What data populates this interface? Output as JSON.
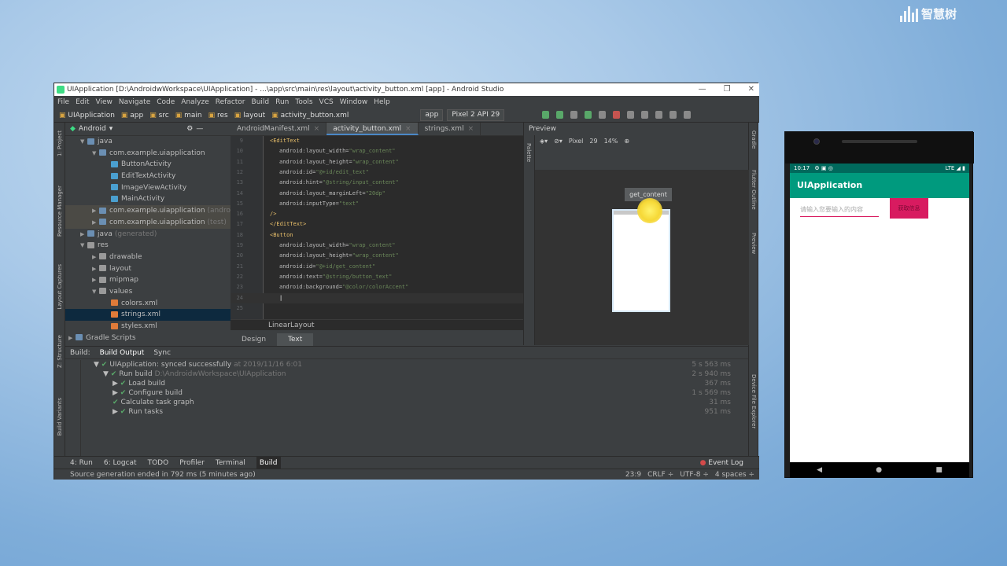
{
  "logo": {
    "text": "智慧树"
  },
  "studio": {
    "title": "UIApplication [D:\\AndroidwWorkspace\\UIApplication] - ...\\app\\src\\main\\res\\layout\\activity_button.xml [app] - Android Studio",
    "menu": [
      "File",
      "Edit",
      "View",
      "Navigate",
      "Code",
      "Analyze",
      "Refactor",
      "Build",
      "Run",
      "Tools",
      "VCS",
      "Window",
      "Help"
    ],
    "breadcrumbs": [
      "UIApplication",
      "app",
      "src",
      "main",
      "res",
      "layout",
      "activity_button.xml"
    ],
    "run_config": "app",
    "device": "Pixel 2 API 29",
    "left_strip": [
      "1: Project",
      "Resource Manager",
      "Layout Captures",
      "Z: Structure",
      "Build Variants"
    ],
    "right_strip": [
      "Gradle",
      "Flutter Outline",
      "Preview",
      "Device File Explorer"
    ],
    "project_view": "Android",
    "tree": [
      {
        "label": "java",
        "indent": 1,
        "arrow": "▼",
        "color": "#6b8fb3"
      },
      {
        "label": "com.example.uiapplication",
        "indent": 2,
        "arrow": "▼",
        "color": "#6b8fb3"
      },
      {
        "label": "ButtonActivity",
        "indent": 3,
        "arrow": "",
        "color": "#4a9fcf"
      },
      {
        "label": "EditTextActivity",
        "indent": 3,
        "arrow": "",
        "color": "#4a9fcf"
      },
      {
        "label": "ImageViewActivity",
        "indent": 3,
        "arrow": "",
        "color": "#4a9fcf"
      },
      {
        "label": "MainActivity",
        "indent": 3,
        "arrow": "",
        "color": "#4a9fcf"
      },
      {
        "label": "com.example.uiapplication",
        "suffix": "(androidTest)",
        "indent": 2,
        "arrow": "▶",
        "color": "#6b8fb3",
        "hl": true
      },
      {
        "label": "com.example.uiapplication",
        "suffix": "(test)",
        "indent": 2,
        "arrow": "▶",
        "color": "#6b8fb3",
        "hl": true
      },
      {
        "label": "java",
        "suffix": "(generated)",
        "indent": 1,
        "arrow": "▶",
        "color": "#6b8fb3"
      },
      {
        "label": "res",
        "indent": 1,
        "arrow": "▼",
        "color": "#9a9a9a"
      },
      {
        "label": "drawable",
        "indent": 2,
        "arrow": "▶",
        "color": "#9a9a9a"
      },
      {
        "label": "layout",
        "indent": 2,
        "arrow": "▶",
        "color": "#9a9a9a"
      },
      {
        "label": "mipmap",
        "indent": 2,
        "arrow": "▶",
        "color": "#9a9a9a"
      },
      {
        "label": "values",
        "indent": 2,
        "arrow": "▼",
        "color": "#9a9a9a"
      },
      {
        "label": "colors.xml",
        "indent": 3,
        "arrow": "",
        "color": "#e07b39"
      },
      {
        "label": "strings.xml",
        "indent": 3,
        "arrow": "",
        "color": "#e07b39",
        "selected": true
      },
      {
        "label": "styles.xml",
        "indent": 3,
        "arrow": "",
        "color": "#e07b39"
      },
      {
        "label": "Gradle Scripts",
        "indent": 0,
        "arrow": "▶",
        "color": "#6b8fb3"
      }
    ],
    "editor_tabs": [
      {
        "label": "AndroidManifest.xml",
        "active": false
      },
      {
        "label": "activity_button.xml",
        "active": true
      },
      {
        "label": "strings.xml",
        "active": false
      }
    ],
    "code": [
      {
        "n": "9",
        "t": "tag",
        "text": "<EditText"
      },
      {
        "n": "10",
        "t": "attr",
        "a": "android:layout_width=",
        "v": "\"wrap_content\""
      },
      {
        "n": "11",
        "t": "attr",
        "a": "android:layout_height=",
        "v": "\"wrap_content\""
      },
      {
        "n": "12",
        "t": "attr",
        "a": "android:id=",
        "v": "\"@+id/edit_text\""
      },
      {
        "n": "13",
        "t": "attr",
        "a": "android:hint=",
        "v": "\"@string/input_content\""
      },
      {
        "n": "14",
        "t": "attr",
        "a": "android:layout_marginLeft=",
        "v": "\"20dp\""
      },
      {
        "n": "15",
        "t": "attr",
        "a": "android:inputType=",
        "v": "\"text\""
      },
      {
        "n": "16",
        "t": "tag",
        "text": "/>"
      },
      {
        "n": "17",
        "t": "tag",
        "text": "</EditText>"
      },
      {
        "n": "18",
        "t": "tag",
        "text": "<Button"
      },
      {
        "n": "19",
        "t": "attr",
        "a": "android:layout_width=",
        "v": "\"wrap_content\""
      },
      {
        "n": "20",
        "t": "attr",
        "a": "android:layout_height=",
        "v": "\"wrap_content\""
      },
      {
        "n": "21",
        "t": "attr",
        "a": "android:id=",
        "v": "\"@+id/get_content\""
      },
      {
        "n": "22",
        "t": "attr",
        "a": "android:text=",
        "v": "\"@string/button_text\""
      },
      {
        "n": "23",
        "t": "attr",
        "a": "android:background=",
        "v": "\"@color/colorAccent\""
      },
      {
        "n": "24",
        "t": "cur",
        "text": ""
      },
      {
        "n": "25",
        "t": "tag",
        "text": ""
      }
    ],
    "editor_footer": "LinearLayout",
    "design_tabs": [
      "Design",
      "Text"
    ],
    "preview": {
      "title": "Preview",
      "palette": "Palette",
      "device": "Pixel",
      "api": "29",
      "zoom": "14%",
      "button_text": "get_content"
    },
    "build": {
      "tabs": [
        "Build:",
        "Build Output",
        "Sync"
      ],
      "rows": [
        {
          "indent": 0,
          "arrow": "▼",
          "label": "UIApplication:",
          "detail": "synced successfully",
          "extra": "at 2019/11/16 6:01",
          "time": "5 s 563 ms"
        },
        {
          "indent": 1,
          "arrow": "▼",
          "label": "Run build",
          "detail": "",
          "extra": "D:\\AndroidwWorkspace\\UIApplication",
          "time": "2 s 940 ms"
        },
        {
          "indent": 2,
          "arrow": "▶",
          "label": "Load build",
          "detail": "",
          "extra": "",
          "time": "367 ms"
        },
        {
          "indent": 2,
          "arrow": "▶",
          "label": "Configure build",
          "detail": "",
          "extra": "",
          "time": "1 s 569 ms"
        },
        {
          "indent": 2,
          "arrow": "",
          "label": "Calculate task graph",
          "detail": "",
          "extra": "",
          "time": "31 ms"
        },
        {
          "indent": 2,
          "arrow": "▶",
          "label": "Run tasks",
          "detail": "",
          "extra": "",
          "time": "951 ms"
        }
      ]
    },
    "bottom_tabs": [
      {
        "label": "4: Run",
        "active": false
      },
      {
        "label": "6: Logcat",
        "active": false
      },
      {
        "label": "TODO",
        "active": false
      },
      {
        "label": "Profiler",
        "active": false
      },
      {
        "label": "Terminal",
        "active": false
      },
      {
        "label": "Build",
        "active": true
      }
    ],
    "event_log": "Event Log",
    "status": "Source generation ended in 792 ms (5 minutes ago)",
    "status_right": [
      "23:9",
      "CRLF ÷",
      "UTF-8 ÷",
      "4 spaces ÷"
    ]
  },
  "phone": {
    "time": "10:17",
    "signal": "LTE",
    "app_title": "UIApplication",
    "input_hint": "请输入您要输入的内容",
    "button_text": "获取信息",
    "nav": [
      "◀",
      "●",
      "■"
    ]
  }
}
